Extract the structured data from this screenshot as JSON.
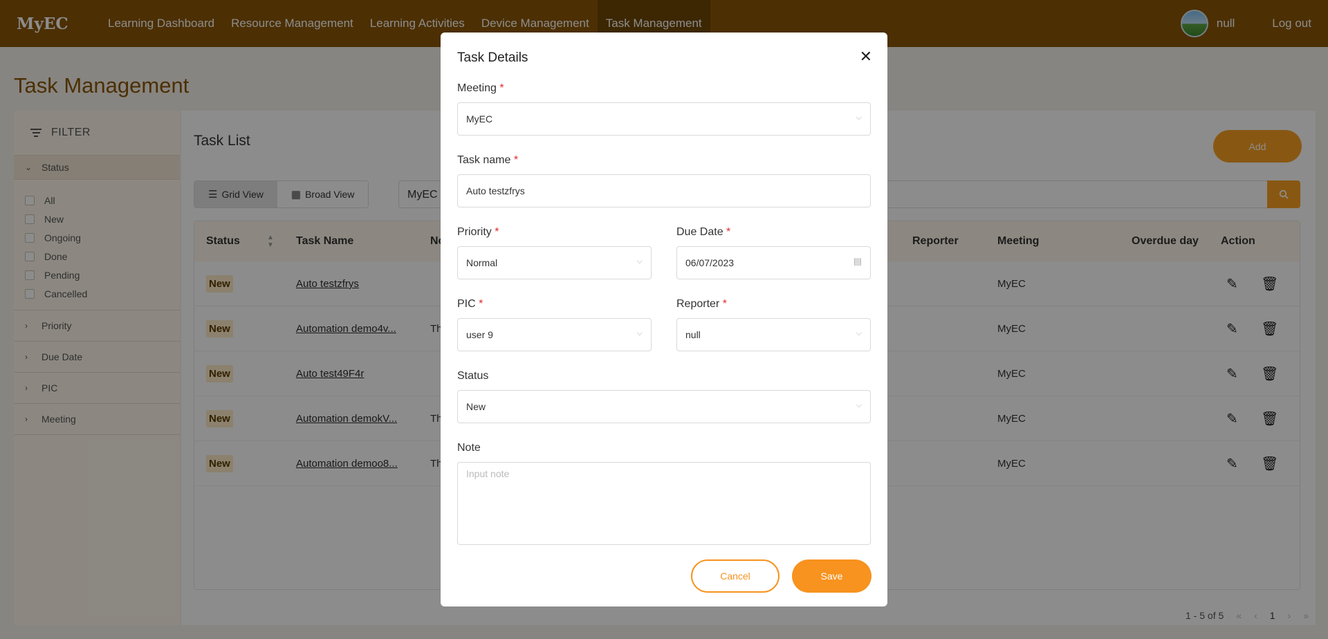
{
  "nav": {
    "brand": "MyEC",
    "items": [
      "Learning Dashboard",
      "Resource Management",
      "Learning Activities",
      "Device Management",
      "Task Management"
    ],
    "active": "Task Management",
    "user_name": "null",
    "logout_label": "Log out"
  },
  "page": {
    "title": "Task Management"
  },
  "filter": {
    "heading": "FILTER",
    "status_section": "Status",
    "status_options": [
      "All",
      "New",
      "Ongoing",
      "Done",
      "Pending",
      "Cancelled"
    ],
    "sections": [
      "Priority",
      "Due Date",
      "PIC",
      "Meeting"
    ]
  },
  "task_list": {
    "title": "Task List",
    "add_label": "Add",
    "grid_view_label": "Grid View",
    "broad_view_label": "Broad View",
    "search_value": "MyEC",
    "columns": {
      "status": "Status",
      "task_name": "Task Name",
      "note": "No",
      "reporter": "Reporter",
      "meeting": "Meeting",
      "overdue": "Overdue day",
      "action": "Action"
    },
    "rows": [
      {
        "status": "New",
        "task_name": "Auto testzfrys",
        "note": "",
        "meeting": "MyEC"
      },
      {
        "status": "New",
        "task_name": "Automation demo4v...",
        "note": "Th",
        "meeting": "MyEC"
      },
      {
        "status": "New",
        "task_name": "Auto test49F4r",
        "note": "",
        "meeting": "MyEC"
      },
      {
        "status": "New",
        "task_name": "Automation demokV...",
        "note": "Th",
        "meeting": "MyEC"
      },
      {
        "status": "New",
        "task_name": "Automation demoo8...",
        "note": "Th",
        "meeting": "MyEC"
      }
    ],
    "pagination": {
      "range": "1 - 5 of 5",
      "current_page": "1"
    }
  },
  "modal": {
    "title": "Task Details",
    "meeting_label": "Meeting",
    "meeting_value": "MyEC",
    "task_name_label": "Task name",
    "task_name_value": "Auto testzfrys",
    "priority_label": "Priority",
    "priority_value": "Normal",
    "due_date_label": "Due Date",
    "due_date_value": "06/07/2023",
    "pic_label": "PIC",
    "pic_value": "user 9",
    "reporter_label": "Reporter",
    "reporter_value": "null",
    "status_label": "Status",
    "status_value": "New",
    "note_label": "Note",
    "note_placeholder": "Input note",
    "cancel_label": "Cancel",
    "save_label": "Save"
  },
  "colors": {
    "nav_bg": "#8a5706",
    "accent": "#f7931e",
    "badge_bg": "#fdecc6",
    "required": "#e02b2b"
  }
}
